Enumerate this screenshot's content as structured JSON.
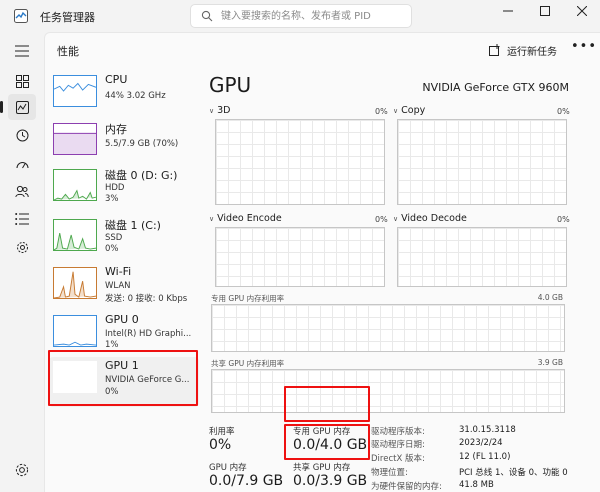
{
  "app": {
    "title": "任务管理器"
  },
  "search": {
    "placeholder": "键入要搜索的名称、发布者或 PID"
  },
  "header": {
    "title": "性能",
    "run_task": "运行新任务"
  },
  "devices": [
    {
      "name": "CPU",
      "sub1": "44%  3.02 GHz",
      "sub2": "",
      "color": "#3b8ede"
    },
    {
      "name": "内存",
      "sub1": "5.5/7.9 GB (70%)",
      "sub2": "",
      "color": "#8c3fb0"
    },
    {
      "name": "磁盘 0 (D: G:)",
      "sub1": "HDD",
      "sub2": "3%",
      "color": "#4ea84e"
    },
    {
      "name": "磁盘 1 (C:)",
      "sub1": "SSD",
      "sub2": "0%",
      "color": "#4ea84e"
    },
    {
      "name": "Wi-Fi",
      "sub1": "WLAN",
      "sub2": "发送: 0 接收: 0 Kbps",
      "color": "#c77a32"
    },
    {
      "name": "GPU 0",
      "sub1": "Intel(R) HD Graphi...",
      "sub2": "1%",
      "color": "#3b8ede"
    },
    {
      "name": "GPU 1",
      "sub1": "NVIDIA GeForce G...",
      "sub2": "0%",
      "color": "#3b8ede"
    }
  ],
  "gpu": {
    "title": "GPU",
    "model": "NVIDIA GeForce GTX 960M",
    "engines": [
      {
        "label": "3D",
        "pct": "0%"
      },
      {
        "label": "Copy",
        "pct": "0%"
      },
      {
        "label": "Video Encode",
        "pct": "0%"
      },
      {
        "label": "Video Decode",
        "pct": "0%"
      }
    ],
    "dedicated_usage_label": "专用 GPU 内存利用率",
    "dedicated_usage_max": "4.0 GB",
    "shared_usage_label": "共享 GPU 内存利用率",
    "shared_usage_max": "3.9 GB"
  },
  "stats": {
    "util_label": "利用率",
    "util_value": "0%",
    "dedicated_label": "专用 GPU 内存",
    "dedicated_value": "0.0/4.0 GB",
    "gpu_mem_label": "GPU 内存",
    "gpu_mem_value": "0.0/7.9 GB",
    "shared_label": "共享 GPU 内存",
    "shared_value": "0.0/3.9 GB"
  },
  "info": [
    {
      "k": "驱动程序版本:",
      "v": "31.0.15.3118"
    },
    {
      "k": "驱动程序日期:",
      "v": "2023/2/24"
    },
    {
      "k": "DirectX 版本:",
      "v": "12 (FL 11.0)"
    },
    {
      "k": "物理位置:",
      "v": "PCI 总线 1、设备 0、功能 0"
    },
    {
      "k": "为硬件保留的内存:",
      "v": "41.8 MB"
    }
  ],
  "colors": {
    "highlight": "#ee1111",
    "cpu": "#3b8ede",
    "memory": "#8c3fb0",
    "disk": "#4ea84e",
    "wifi": "#c77a32"
  }
}
